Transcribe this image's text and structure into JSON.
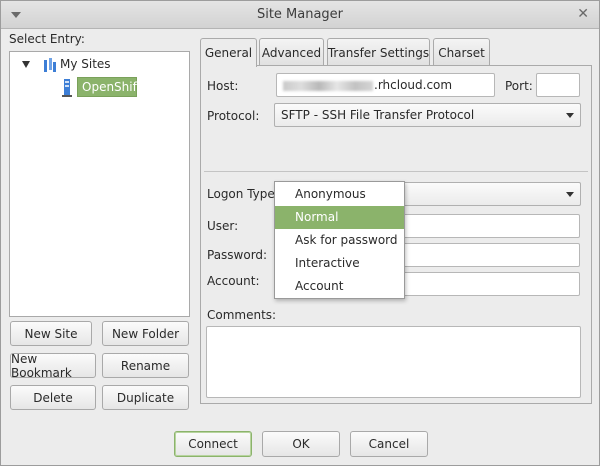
{
  "window": {
    "title": "Site Manager"
  },
  "left": {
    "select_entry_label": "Select Entry:",
    "tree": {
      "root": "My Sites",
      "child": "OpenShift"
    },
    "buttons": {
      "new_site": "New Site",
      "new_folder": "New Folder",
      "new_bookmark": "New Bookmark",
      "rename": "Rename",
      "delete": "Delete",
      "duplicate": "Duplicate"
    }
  },
  "tabs": [
    "General",
    "Advanced",
    "Transfer Settings",
    "Charset"
  ],
  "general": {
    "host_label": "Host:",
    "host_value_suffix": ".rhcloud.com",
    "port_label": "Port:",
    "port_value": "",
    "protocol_label": "Protocol:",
    "protocol_value": "SFTP - SSH File Transfer Protocol",
    "logon_type_label": "Logon Type:",
    "user_label": "User:",
    "password_label": "Password:",
    "account_label": "Account:",
    "comments_label": "Comments:"
  },
  "logon_dropdown": {
    "options": [
      "Anonymous",
      "Normal",
      "Ask for password",
      "Interactive",
      "Account"
    ],
    "highlighted": "Normal"
  },
  "footer": {
    "connect": "Connect",
    "ok": "OK",
    "cancel": "Cancel"
  },
  "colors": {
    "accent": "#8bb36b",
    "folder_blue": "#3d7ed6"
  }
}
